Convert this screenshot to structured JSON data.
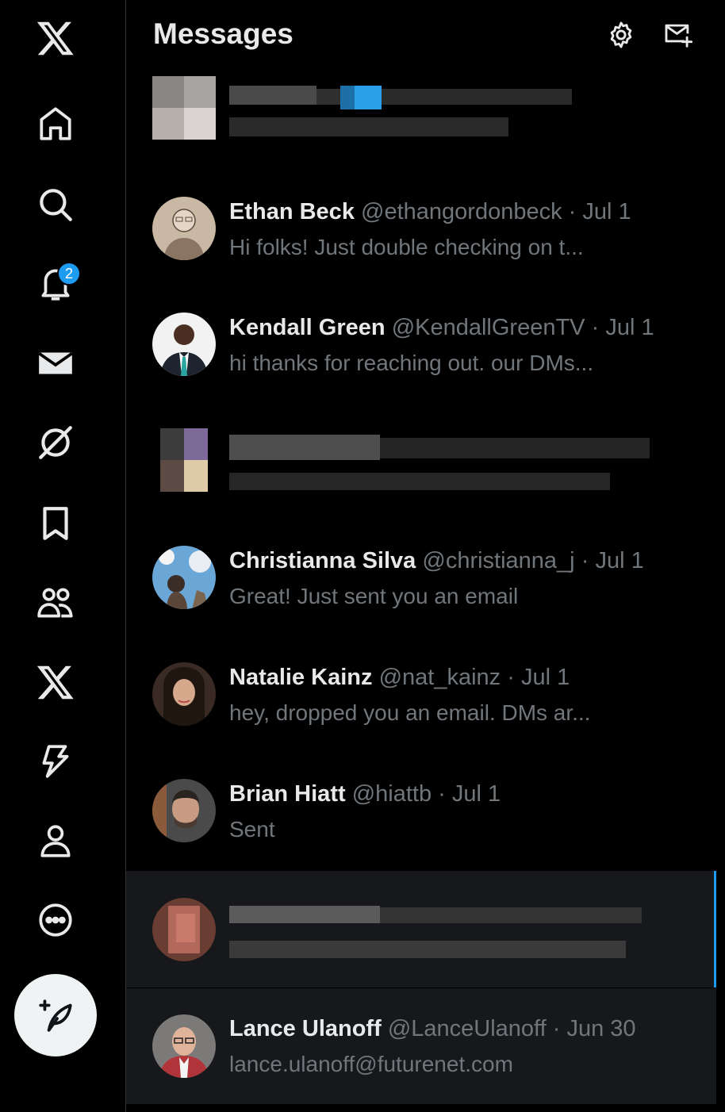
{
  "nav": {
    "notifications_badge": "2"
  },
  "header": {
    "title": "Messages"
  },
  "conversations": [
    {
      "name": "Ethan Beck",
      "handle": "@ethangordonbeck",
      "date": "Jul 1",
      "preview": "Hi folks! Just double checking on t..."
    },
    {
      "name": "Kendall Green",
      "handle": "@KendallGreenTV",
      "date": "Jul 1",
      "preview": "hi thanks for reaching out. our DMs..."
    },
    {
      "name": "Christianna Silva",
      "handle": "@christianna_j",
      "date": "Jul 1",
      "preview": "Great! Just sent you an email"
    },
    {
      "name": "Natalie Kainz",
      "handle": "@nat_kainz",
      "date": "Jul 1",
      "preview": "hey, dropped you an email. DMs ar..."
    },
    {
      "name": "Brian Hiatt",
      "handle": "@hiattb",
      "date": "Jul 1",
      "preview": "Sent"
    },
    {
      "name": "Lance Ulanoff",
      "handle": "@LanceUlanoff",
      "date": "Jun 30",
      "preview": "lance.ulanoff@futurenet.com"
    }
  ],
  "separator": "·",
  "colors": {
    "accent": "#1d9bf0",
    "muted_text": "#71767b",
    "text": "#e7e9ea",
    "selected_bg": "#16181c"
  },
  "icons": [
    "x-logo-icon",
    "home-icon",
    "search-icon",
    "bell-icon",
    "mail-icon",
    "grok-icon",
    "bookmark-icon",
    "communities-icon",
    "premium-x-icon",
    "verified-orgs-icon",
    "profile-icon",
    "more-icon",
    "compose-post-icon",
    "settings-icon",
    "new-message-icon"
  ]
}
